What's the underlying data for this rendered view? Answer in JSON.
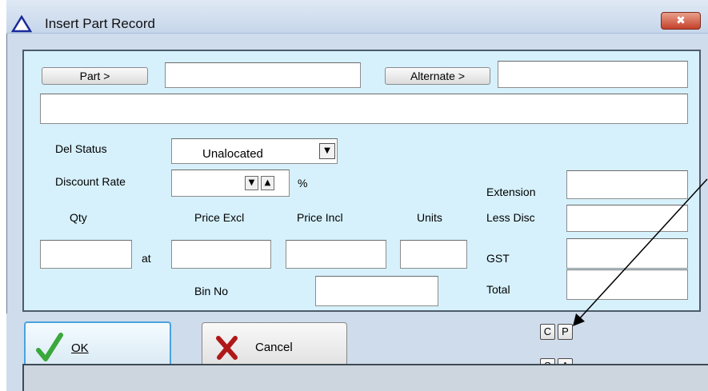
{
  "window": {
    "title": "Insert Part Record",
    "close_label": "✖"
  },
  "form": {
    "part_button": "Part >",
    "part_value": "",
    "alternate_button": "Alternate >",
    "alternate_value": "",
    "description_value": "",
    "del_status_label": "Del Status",
    "del_status_value": "Unalocated",
    "discount_rate_label": "Discount Rate",
    "discount_rate_value": "",
    "percent_label": "%",
    "qty_label": "Qty",
    "price_excl_label": "Price Excl",
    "price_incl_label": "Price Incl",
    "units_label": "Units",
    "at_label": "at",
    "bin_no_label": "Bin No",
    "qty_value": "",
    "price_excl_value": "",
    "price_incl_value": "",
    "units_value": "",
    "bin_no_value": "",
    "extension_label": "Extension",
    "less_disc_label": "Less Disc",
    "gst_label": "GST",
    "total_label": "Total",
    "extension_value": "",
    "less_disc_value": "",
    "gst_value": "",
    "total_value": ""
  },
  "buttons": {
    "ok_label": "OK",
    "cancel_label": "Cancel",
    "c_label": "C",
    "p_label": "P",
    "s_label": "S",
    "a_label": "A"
  },
  "colors": {
    "panel_bg": "#d6f1fc",
    "window_bg": "#cfdcec",
    "ok_check": "#3aa83a",
    "cancel_x": "#b01818"
  }
}
